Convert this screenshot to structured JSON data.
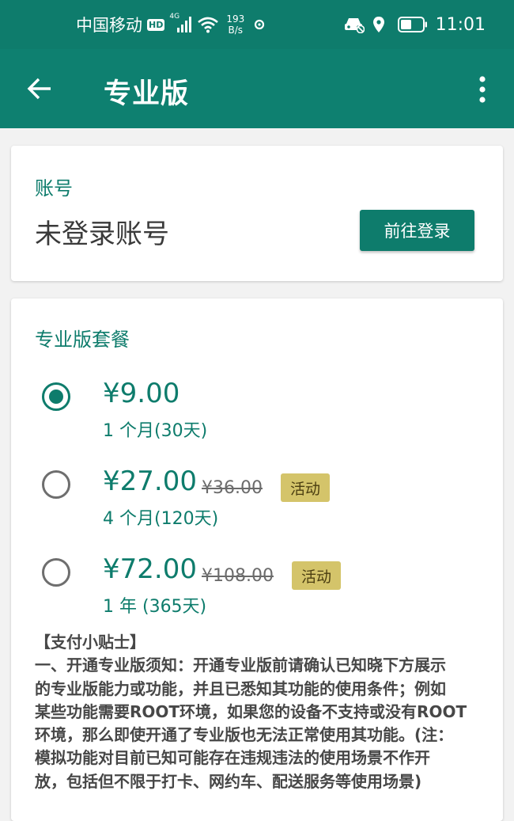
{
  "status_bar": {
    "carrier": "中国移动",
    "hd_badge": "HD",
    "network_type": "4G",
    "net_speed_value": "193",
    "net_speed_unit": "B/s",
    "time": "11:01"
  },
  "app_bar": {
    "title": "专业版"
  },
  "account": {
    "section_label": "账号",
    "status": "未登录账号",
    "login_button": "前往登录"
  },
  "plans": {
    "section_label": "专业版套餐",
    "items": [
      {
        "price": "¥9.00",
        "original_price": "",
        "badge": "",
        "duration": "1 个月(30天)",
        "selected": true
      },
      {
        "price": "¥27.00",
        "original_price": "¥36.00",
        "badge": "活动",
        "duration": "4 个月(120天)",
        "selected": false
      },
      {
        "price": "¥72.00",
        "original_price": "¥108.00",
        "badge": "活动",
        "duration": "1 年 (365天)",
        "selected": false
      }
    ]
  },
  "tips": {
    "title": "【支付小贴士】",
    "lines": [
      "一、开通专业版须知：开通专业版前请确认已知晓下方展示",
      "的专业版能力或功能，并且已悉知其功能的使用条件；例如",
      "某些功能需要ROOT环境，如果您的设备不支持或没有ROOT",
      "环境，那么即使开通了专业版也无法正常使用其功能。(注：",
      "模拟功能对目前已知可能存在违规违法的使用场景不作开",
      "放，包括但不限于打卡、网约车、配送服务等使用场景)"
    ]
  },
  "colors": {
    "primary": "#0e7c6c",
    "badge_bg": "#d4c46a",
    "page_bg": "#f2f2f2"
  },
  "icons": [
    "signal-icon",
    "wifi-icon",
    "settings-gear-icon",
    "car-icon",
    "location-icon",
    "battery-icon",
    "back-arrow-icon",
    "more-vert-icon"
  ]
}
